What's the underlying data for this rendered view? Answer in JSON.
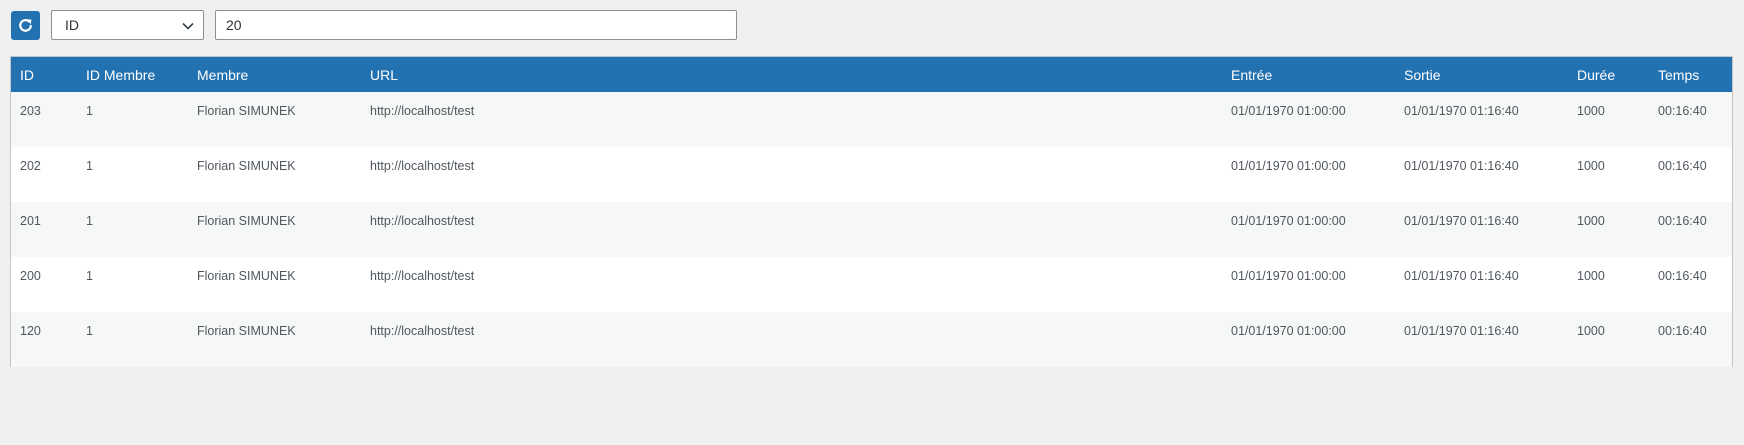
{
  "toolbar": {
    "filter_field": "ID",
    "search_value": "20"
  },
  "colors": {
    "accent": "#2271b1",
    "header_text": "#ffffff",
    "row_alt": "#f6f7f7",
    "background": "#f0f0f1"
  },
  "icons": {
    "refresh": "refresh-icon",
    "dropdown": "chevron-down-icon"
  },
  "table": {
    "columns": [
      "ID",
      "ID Membre",
      "Membre",
      "URL",
      "Entrée",
      "Sortie",
      "Durée",
      "Temps"
    ],
    "rows": [
      [
        "203",
        "1",
        "Florian SIMUNEK",
        "http://localhost/test",
        "01/01/1970 01:00:00",
        "01/01/1970 01:16:40",
        "1000",
        "00:16:40"
      ],
      [
        "202",
        "1",
        "Florian SIMUNEK",
        "http://localhost/test",
        "01/01/1970 01:00:00",
        "01/01/1970 01:16:40",
        "1000",
        "00:16:40"
      ],
      [
        "201",
        "1",
        "Florian SIMUNEK",
        "http://localhost/test",
        "01/01/1970 01:00:00",
        "01/01/1970 01:16:40",
        "1000",
        "00:16:40"
      ],
      [
        "200",
        "1",
        "Florian SIMUNEK",
        "http://localhost/test",
        "01/01/1970 01:00:00",
        "01/01/1970 01:16:40",
        "1000",
        "00:16:40"
      ],
      [
        "120",
        "1",
        "Florian SIMUNEK",
        "http://localhost/test",
        "01/01/1970 01:00:00",
        "01/01/1970 01:16:40",
        "1000",
        "00:16:40"
      ]
    ]
  }
}
